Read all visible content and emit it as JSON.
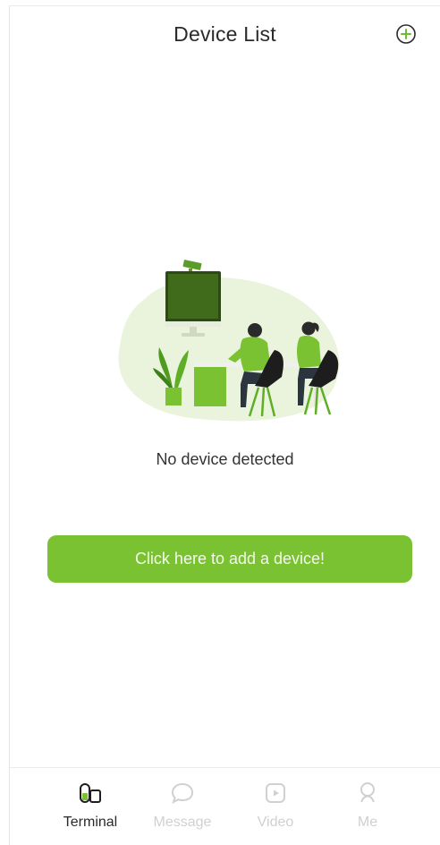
{
  "header": {
    "title": "Device List",
    "add_icon": "plus-circle-icon"
  },
  "empty_state": {
    "illustration": "office-workstation-illustration",
    "message": "No device detected"
  },
  "cta": {
    "label": "Click here to add a device!"
  },
  "tabs": [
    {
      "label": "Terminal",
      "icon": "terminal-devices-icon",
      "active": true
    },
    {
      "label": "Message",
      "icon": "chat-bubble-icon",
      "active": false
    },
    {
      "label": "Video",
      "icon": "video-play-icon",
      "active": false
    },
    {
      "label": "Me",
      "icon": "person-icon",
      "active": false
    }
  ],
  "colors": {
    "accent": "#7ac232",
    "accent_dark": "#4f9a1f",
    "inactive": "#d0d0d0"
  }
}
